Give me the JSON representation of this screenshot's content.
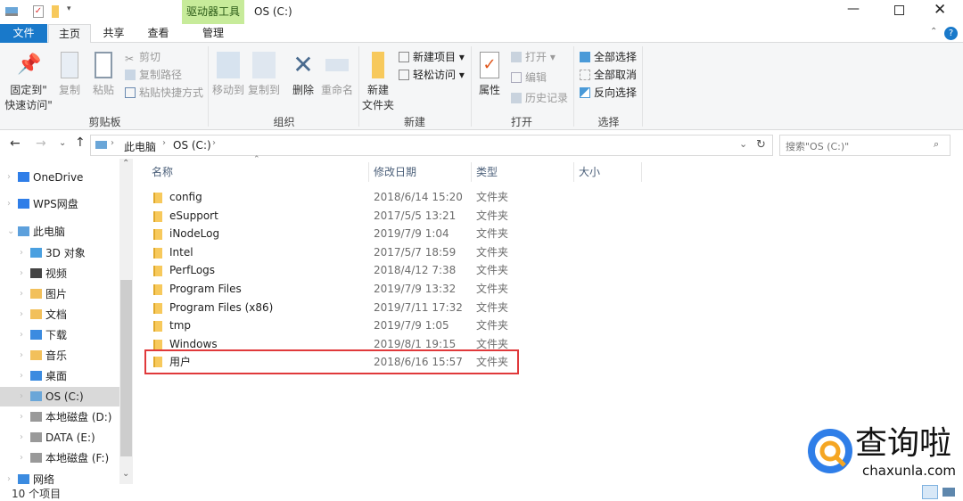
{
  "window": {
    "title": "OS (C:)",
    "context_tab_group": "驱动器工具"
  },
  "tabs": [
    {
      "label": "文件"
    },
    {
      "label": "主页"
    },
    {
      "label": "共享"
    },
    {
      "label": "查看"
    },
    {
      "label": "管理"
    }
  ],
  "ribbon": {
    "clipboard": {
      "pin": "固定到\"快速访问\"",
      "pin_line1": "固定到\"",
      "pin_line2": "快速访问\"",
      "copy": "复制",
      "paste": "粘贴",
      "cut": "剪切",
      "copy_path": "复制路径",
      "paste_shortcut": "粘贴快捷方式",
      "label": "剪贴板"
    },
    "organize": {
      "move_to": "移动到",
      "copy_to": "复制到",
      "delete": "删除",
      "rename": "重命名",
      "label": "组织"
    },
    "new": {
      "new_folder_line1": "新建",
      "new_folder_line2": "文件夹",
      "new_item": "新建项目",
      "easy_access": "轻松访问",
      "label": "新建"
    },
    "open": {
      "properties": "属性",
      "open": "打开",
      "edit": "编辑",
      "history": "历史记录",
      "label": "打开"
    },
    "select": {
      "select_all": "全部选择",
      "select_none": "全部取消",
      "invert": "反向选择",
      "label": "选择"
    }
  },
  "address": {
    "crumbs": [
      "此电脑",
      "OS (C:)"
    ],
    "search_placeholder": "搜索\"OS (C:)\""
  },
  "nav": [
    {
      "label": "OneDrive",
      "level": 0
    },
    {
      "label": "WPS网盘",
      "level": 0
    },
    {
      "label": "此电脑",
      "level": 0
    },
    {
      "label": "3D 对象",
      "level": 1
    },
    {
      "label": "视频",
      "level": 1
    },
    {
      "label": "图片",
      "level": 1
    },
    {
      "label": "文档",
      "level": 1
    },
    {
      "label": "下载",
      "level": 1
    },
    {
      "label": "音乐",
      "level": 1
    },
    {
      "label": "桌面",
      "level": 1
    },
    {
      "label": "OS (C:)",
      "level": 1,
      "selected": true
    },
    {
      "label": "本地磁盘 (D:)",
      "level": 1
    },
    {
      "label": "DATA (E:)",
      "level": 1
    },
    {
      "label": "本地磁盘 (F:)",
      "level": 1
    },
    {
      "label": "网络",
      "level": 0
    }
  ],
  "columns": {
    "name": "名称",
    "date": "修改日期",
    "type": "类型",
    "size": "大小"
  },
  "files": [
    {
      "name": "config",
      "date": "2018/6/14 15:20",
      "type": "文件夹"
    },
    {
      "name": "eSupport",
      "date": "2017/5/5 13:21",
      "type": "文件夹"
    },
    {
      "name": "iNodeLog",
      "date": "2019/7/9 1:04",
      "type": "文件夹"
    },
    {
      "name": "Intel",
      "date": "2017/5/7 18:59",
      "type": "文件夹"
    },
    {
      "name": "PerfLogs",
      "date": "2018/4/12 7:38",
      "type": "文件夹"
    },
    {
      "name": "Program Files",
      "date": "2019/7/9 13:32",
      "type": "文件夹"
    },
    {
      "name": "Program Files (x86)",
      "date": "2019/7/11 17:32",
      "type": "文件夹"
    },
    {
      "name": "tmp",
      "date": "2019/7/9 1:05",
      "type": "文件夹"
    },
    {
      "name": "Windows",
      "date": "2019/8/1 19:15",
      "type": "文件夹"
    },
    {
      "name": "用户",
      "date": "2018/6/16 15:57",
      "type": "文件夹",
      "highlighted": true
    }
  ],
  "status": {
    "count": "10 个项目"
  },
  "watermark": {
    "text": "查询啦",
    "url": "chaxunla.com"
  },
  "colors": {
    "accent": "#1979ca",
    "context_tab": "#c7eb9a",
    "highlight_box": "#e0393b",
    "selected_nav": "#d9d9d9"
  }
}
